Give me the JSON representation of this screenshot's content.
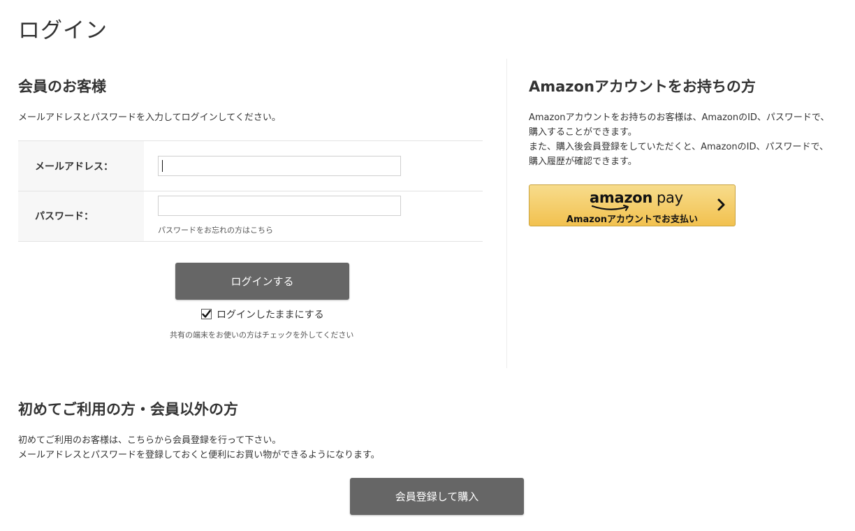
{
  "page": {
    "title": "ログイン"
  },
  "member": {
    "heading": "会員のお客様",
    "intro": "メールアドレスとパスワードを入力してログインしてください。",
    "email_label": "メールアドレス：",
    "email_value": "",
    "password_label": "パスワード：",
    "password_value": "",
    "forgot_link": "パスワードをお忘れの方はこちら",
    "login_button": "ログインする",
    "remember_label": "ログインしたままにする",
    "remember_checked": true,
    "remember_note": "共有の端末をお使いの方はチェックを外してください"
  },
  "amazon": {
    "heading": "Amazonアカウントをお持ちの方",
    "desc_lines": [
      "Amazonアカウントをお持ちのお客様は、AmazonのID、パスワードで、",
      "購入することができます。",
      "また、購入後会員登録をしていただくと、AmazonのID、パスワードで、",
      "購入履歴が確認できます。"
    ],
    "logo_text": "amazon",
    "logo_pay": "pay",
    "button_sub": "Amazonアカウントでお支払い",
    "button_color": "#f2c14f"
  },
  "guest": {
    "heading": "初めてご利用の方・会員以外の方",
    "desc_lines": [
      "初めてご利用のお客様は、こちらから会員登録を行って下さい。",
      "メールアドレスとパスワードを登録しておくと便利にお買い物ができるようになります。"
    ],
    "register_button": "会員登録して購入"
  },
  "icons": {
    "checkbox": "checkmark-icon",
    "amazon_chevron": "chevron-right-icon",
    "amazon_smile": "amazon-smile-icon"
  },
  "colors": {
    "button_gray": "#666666",
    "label_bg": "#f7f7f7",
    "border": "#e3e3e3"
  }
}
